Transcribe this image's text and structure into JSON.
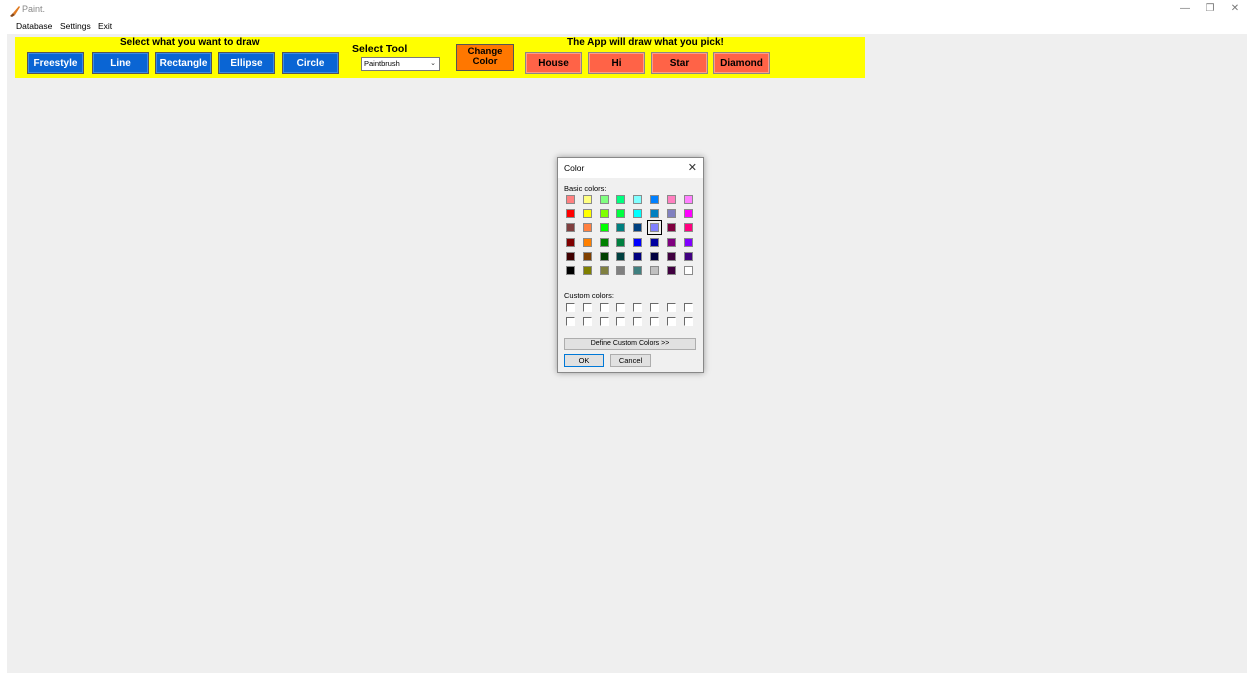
{
  "window": {
    "title": "Paint.",
    "minimize": "—",
    "restore": "❐",
    "close": "✕"
  },
  "menu": {
    "items": [
      "Database",
      "Settings",
      "Exit"
    ]
  },
  "toolbar": {
    "background": "#ffff00",
    "draw_heading": "Select what you want to draw",
    "shape_buttons": [
      "Freestyle",
      "Line",
      "Rectangle",
      "Ellipse",
      "Circle"
    ],
    "tool_heading": "Select Tool",
    "tool_select_value": "Paintbrush",
    "change_color_line1": "Change",
    "change_color_line2": "Color",
    "pick_heading": "The App will draw what you pick!",
    "pick_buttons": [
      "House",
      "Hi",
      "Star",
      "Diamond"
    ],
    "shape_button_color": "#0a65d4",
    "pick_button_color": "#ff6347",
    "change_color_button_color": "#ff7700"
  },
  "color_dialog": {
    "title": "Color",
    "close_icon": "close-icon",
    "basic_colors_label": "Basic colors:",
    "custom_colors_label": "Custom colors:",
    "define_custom_label": "Define Custom Colors >>",
    "ok_label": "OK",
    "cancel_label": "Cancel",
    "selected_index": 21,
    "basic_colors": [
      "#ff8080",
      "#ffff80",
      "#80ff80",
      "#00ff80",
      "#80ffff",
      "#0080ff",
      "#ff80c0",
      "#ff80ff",
      "#ff0000",
      "#ffff00",
      "#80ff00",
      "#00ff40",
      "#00ffff",
      "#0080c0",
      "#8080c0",
      "#ff00ff",
      "#804040",
      "#ff8040",
      "#00ff00",
      "#008080",
      "#004080",
      "#8080ff",
      "#800040",
      "#ff0080",
      "#800000",
      "#ff8000",
      "#008000",
      "#008040",
      "#0000ff",
      "#0000a0",
      "#800080",
      "#8000ff",
      "#400000",
      "#804000",
      "#004000",
      "#004040",
      "#000080",
      "#000040",
      "#400040",
      "#400080",
      "#000000",
      "#808000",
      "#808040",
      "#808080",
      "#408080",
      "#c0c0c0",
      "#400040",
      "#ffffff"
    ],
    "custom_colors": [
      "#ffffff",
      "#ffffff",
      "#ffffff",
      "#ffffff",
      "#ffffff",
      "#ffffff",
      "#ffffff",
      "#ffffff",
      "#ffffff",
      "#ffffff",
      "#ffffff",
      "#ffffff",
      "#ffffff",
      "#ffffff",
      "#ffffff",
      "#ffffff"
    ]
  }
}
